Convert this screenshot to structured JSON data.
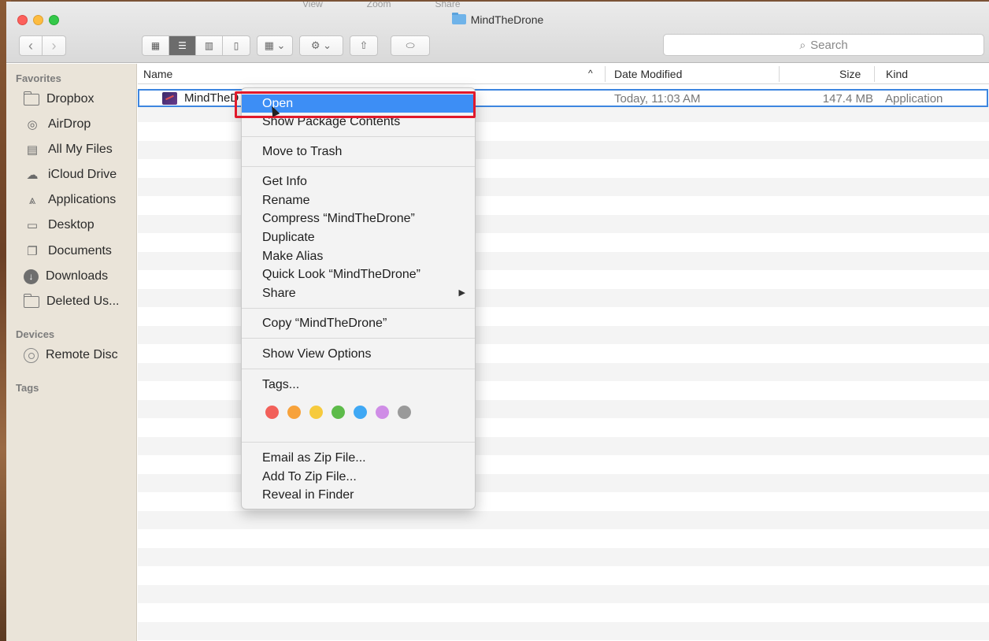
{
  "window": {
    "title": "MindTheDrone",
    "ghost_labels": [
      "View",
      "Zoom",
      "Share"
    ]
  },
  "toolbar": {
    "back_label": "‹",
    "forward_label": "›",
    "search_placeholder": "Search"
  },
  "sidebar": {
    "favorites_header": "Favorites",
    "favorites": [
      {
        "label": "Dropbox",
        "icon": "folder-icon"
      },
      {
        "label": "AirDrop",
        "icon": "airdrop-icon"
      },
      {
        "label": "All My Files",
        "icon": "all-files-icon"
      },
      {
        "label": "iCloud Drive",
        "icon": "cloud-icon"
      },
      {
        "label": "Applications",
        "icon": "applications-icon"
      },
      {
        "label": "Desktop",
        "icon": "desktop-icon"
      },
      {
        "label": "Documents",
        "icon": "documents-icon"
      },
      {
        "label": "Downloads",
        "icon": "downloads-icon"
      },
      {
        "label": "Deleted Us...",
        "icon": "folder-icon"
      }
    ],
    "devices_header": "Devices",
    "devices": [
      {
        "label": "Remote Disc",
        "icon": "disc-icon"
      }
    ],
    "tags_header": "Tags"
  },
  "list": {
    "columns": {
      "name": "Name",
      "sort_indicator": "^",
      "date_modified": "Date Modified",
      "size": "Size",
      "kind": "Kind"
    },
    "rows": [
      {
        "name": "MindTheD",
        "date_modified": "Today, 11:03 AM",
        "size": "147.4 MB",
        "kind": "Application"
      }
    ]
  },
  "context_menu": {
    "open": "Open",
    "show_package_contents": "Show Package Contents",
    "move_to_trash": "Move to Trash",
    "get_info": "Get Info",
    "rename": "Rename",
    "compress": "Compress “MindTheDrone”",
    "duplicate": "Duplicate",
    "make_alias": "Make Alias",
    "quick_look": "Quick Look “MindTheDrone”",
    "share": "Share",
    "copy": "Copy “MindTheDrone”",
    "show_view_options": "Show View Options",
    "tags": "Tags...",
    "tag_colors": [
      "#f2605a",
      "#f7a23b",
      "#f6ca3d",
      "#5dbb4a",
      "#3fa8f4",
      "#cf8de6",
      "#9a9a9a"
    ],
    "email_zip": "Email as Zip File...",
    "add_zip": "Add To Zip File...",
    "reveal_finder": "Reveal in Finder"
  },
  "colors": {
    "highlight": "#3d8ef5",
    "annotation_outline": "#e0192b",
    "sidebar_bg": "#eae4d9"
  }
}
